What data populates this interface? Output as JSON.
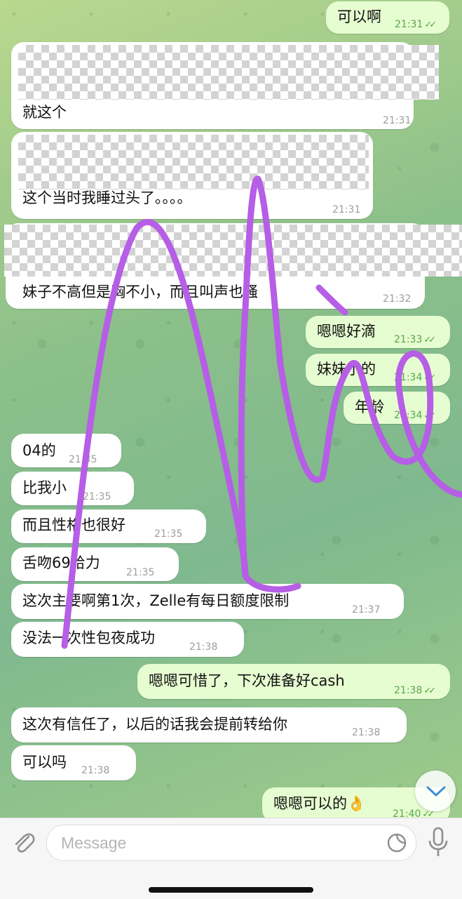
{
  "messages": [
    {
      "text": "可以啊",
      "time": "21:31",
      "out": true
    },
    {
      "text": "就这个",
      "time": "21:31",
      "out": false
    },
    {
      "text": "这个当时我睡过头了。。。。",
      "time": "21:31",
      "out": false
    },
    {
      "text": "妹子不高但是胸不小，而且叫声也骚",
      "time": "21:32",
      "out": false
    },
    {
      "text": "嗯嗯好滴",
      "time": "21:33",
      "out": true
    },
    {
      "text": "妹妹小的",
      "time": "21:34",
      "out": true
    },
    {
      "text": "年龄",
      "time": "21:34",
      "out": true
    },
    {
      "text": "04的",
      "time": "21:35",
      "out": false
    },
    {
      "text": "比我小",
      "time": "21:35",
      "out": false
    },
    {
      "text": "而且性格也很好",
      "time": "21:35",
      "out": false
    },
    {
      "text": "舌吻69给力",
      "time": "21:35",
      "out": false
    },
    {
      "text": "这次主要啊第1次，Zelle有每日额度限制",
      "time": "21:37",
      "out": false
    },
    {
      "text": "没法一次性包夜成功",
      "time": "21:38",
      "out": false
    },
    {
      "text": "嗯嗯可惜了，下次准备好cash",
      "time": "21:38",
      "out": true
    },
    {
      "text": "这次有信任了，以后的话我会提前转给你",
      "time": "21:38",
      "out": false
    },
    {
      "text": "可以吗",
      "time": "21:38",
      "out": false
    },
    {
      "text": "嗯嗯可以的👌",
      "time": "21:40",
      "out": true
    }
  ],
  "composer": {
    "placeholder": "Message"
  },
  "icons": {
    "attach": "paperclip-icon",
    "sticker": "sticker-icon",
    "mic": "microphone-icon",
    "scroll": "chevron-down-icon",
    "read_receipt": "double-check-icon"
  },
  "colors": {
    "outgoing_bubble": "#e6fdd1",
    "incoming_bubble": "#ffffff",
    "scribble": "#b65ee6",
    "tick": "#4ea83f"
  }
}
